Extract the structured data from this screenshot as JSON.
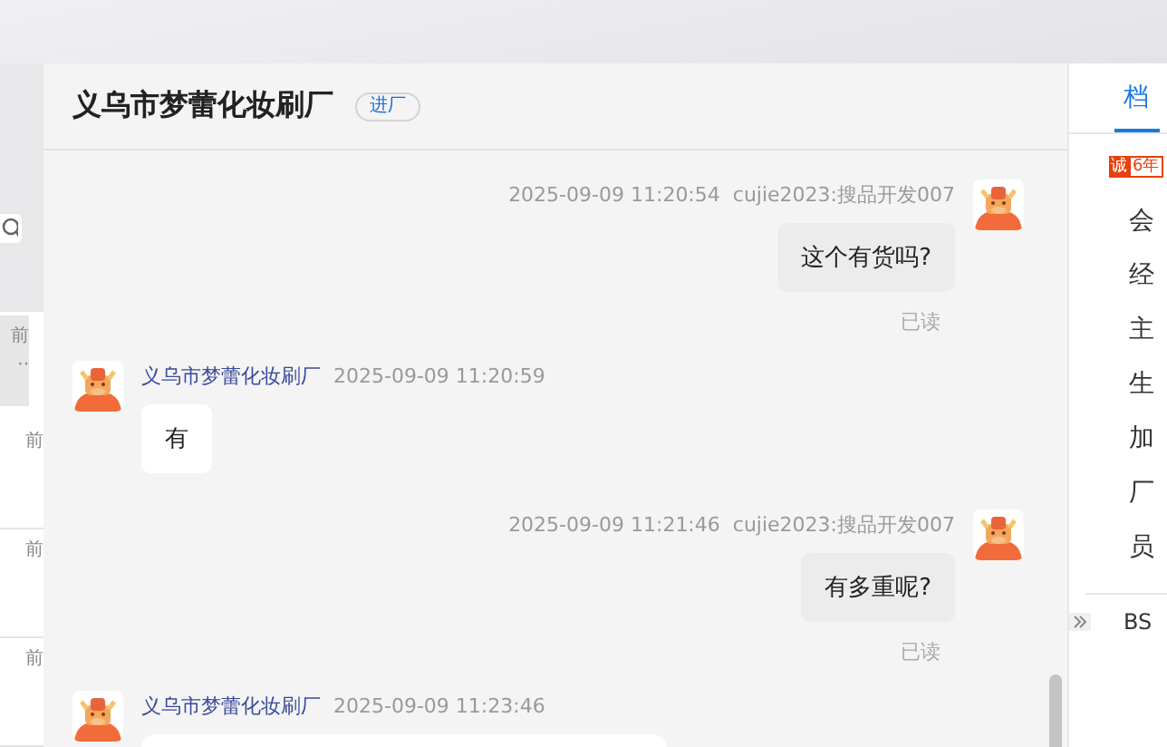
{
  "sidebar": {
    "items": [
      {
        "time": "前",
        "preview": "··",
        "selected": true
      },
      {
        "time": "前",
        "selected": false
      },
      {
        "time": "前",
        "selected": false
      },
      {
        "time": "前",
        "selected": false
      }
    ]
  },
  "chat": {
    "title": "义乌市梦蕾化妆刷厂",
    "badge": "进厂",
    "messages": [
      {
        "kind": "out",
        "time": "2025-09-09 11:20:54",
        "sender": "cujie2023:搜品开发007",
        "text": "这个有货吗?",
        "status": "已读"
      },
      {
        "kind": "in",
        "time": "2025-09-09 11:20:59",
        "sender": "义乌市梦蕾化妆刷厂",
        "text": "有"
      },
      {
        "kind": "out",
        "time": "2025-09-09 11:21:46",
        "sender": "cujie2023:搜品开发007",
        "text": "有多重呢?",
        "status": "已读"
      },
      {
        "kind": "in",
        "time": "2025-09-09 11:23:46",
        "sender": "义乌市梦蕾化妆刷厂"
      }
    ]
  },
  "right_panel": {
    "tab": "档",
    "badge_icon": "诚",
    "badge_years": "6年",
    "rows": [
      "会",
      "经",
      "主",
      "生",
      "加",
      "厂",
      "员"
    ],
    "footer": "BS"
  }
}
